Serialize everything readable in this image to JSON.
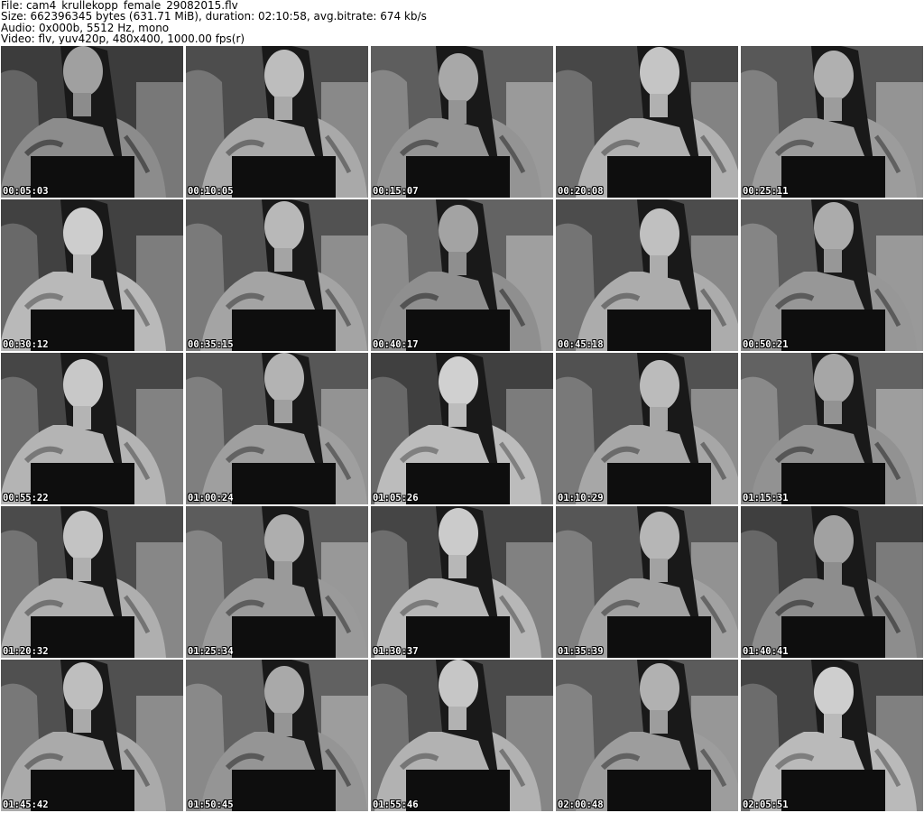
{
  "header": {
    "file_line": "File: cam4_krullekopp_female_29082015.flv",
    "size_line": "Size: 662396345 bytes (631.71 MiB), duration: 02:10:58, avg.bitrate: 674 kb/s",
    "audio_line": "Audio: 0x000b, 5512 Hz, mono",
    "video_line": "Video: flv, yuv420p, 480x400, 1000.00 fps(r)"
  },
  "thumbnails": [
    {
      "time": "00:05:03"
    },
    {
      "time": "00:10:05"
    },
    {
      "time": "00:15:07"
    },
    {
      "time": "00:20:08"
    },
    {
      "time": "00:25:11"
    },
    {
      "time": "00:30:12"
    },
    {
      "time": "00:35:15"
    },
    {
      "time": "00:40:17"
    },
    {
      "time": "00:45:18"
    },
    {
      "time": "00:50:21"
    },
    {
      "time": "00:55:22"
    },
    {
      "time": "01:00:24"
    },
    {
      "time": "01:05:26"
    },
    {
      "time": "01:10:29"
    },
    {
      "time": "01:15:31"
    },
    {
      "time": "01:20:32"
    },
    {
      "time": "01:25:34"
    },
    {
      "time": "01:30:37"
    },
    {
      "time": "01:35:39"
    },
    {
      "time": "01:40:41"
    },
    {
      "time": "01:45:42"
    },
    {
      "time": "01:50:45"
    },
    {
      "time": "01:55:46"
    },
    {
      "time": "02:00:48"
    },
    {
      "time": "02:05:51"
    }
  ]
}
